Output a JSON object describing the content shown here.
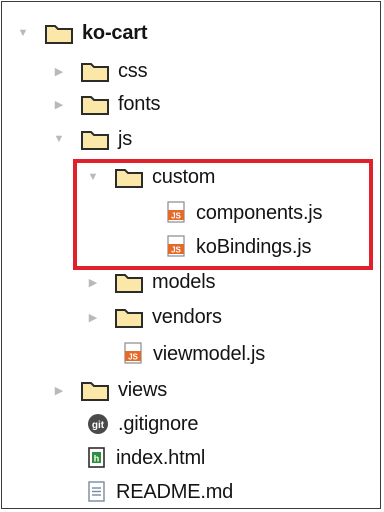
{
  "tree": {
    "root": {
      "label": "ko-cart"
    },
    "items": [
      {
        "label": "css"
      },
      {
        "label": "fonts"
      },
      {
        "label": "js"
      },
      {
        "label": "custom"
      },
      {
        "label": "components.js"
      },
      {
        "label": "koBindings.js"
      },
      {
        "label": "models"
      },
      {
        "label": "vendors"
      },
      {
        "label": "viewmodel.js"
      },
      {
        "label": "views"
      },
      {
        "label": ".gitignore"
      },
      {
        "label": "index.html"
      },
      {
        "label": "README.md"
      }
    ]
  },
  "icons": {
    "folder": "folder-icon",
    "js_file": "js-file-icon",
    "git_file": "git-icon",
    "html_file": "html-file-icon",
    "text_file": "text-file-icon",
    "expanded": "triangle-down-icon",
    "collapsed": "triangle-right-icon"
  },
  "colors": {
    "folder_fill": "#fbe8a8",
    "folder_stroke": "#2c2c2c",
    "highlight": "#e0202a",
    "arrow": "#b9b9b9"
  }
}
